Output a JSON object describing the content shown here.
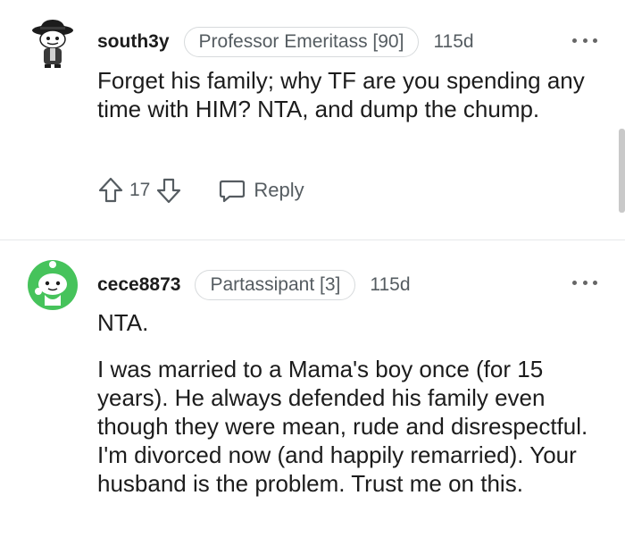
{
  "comments": [
    {
      "username": "south3y",
      "flair": "Professor Emeritass [90]",
      "age": "115d",
      "paragraphs": [
        "Forget his family; why TF are you spending any time with HIM? NTA, and dump the chump."
      ],
      "votes": "17",
      "reply_label": "Reply",
      "avatar_icon": "fedora-snoo-avatar-icon"
    },
    {
      "username": "cece8873",
      "flair": "Partassipant [3]",
      "age": "115d",
      "paragraphs": [
        "NTA.",
        "I was married to a Mama's boy once (for 15 years). He always defended his family even though they were mean, rude and disrespectful. I'm divorced now (and happily remarried). Your husband is the problem. Trust me on this."
      ],
      "avatar_icon": "green-snoo-avatar-icon"
    }
  ],
  "colors": {
    "text": "#1c1c1c",
    "meta": "#555c61",
    "flair_border": "#d7dadc",
    "avatar_green": "#46c35b"
  }
}
